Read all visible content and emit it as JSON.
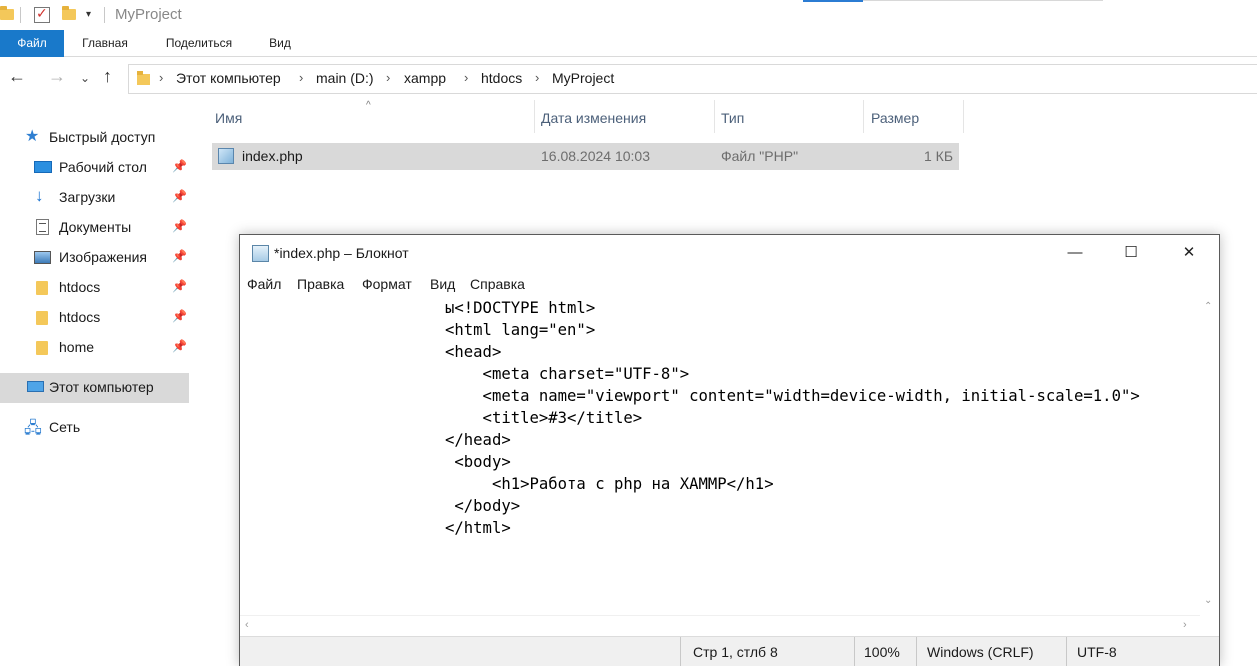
{
  "explorer": {
    "window_title": "MyProject",
    "ribbon": {
      "file": "Файл",
      "home": "Главная",
      "share": "Поделиться",
      "view": "Вид"
    },
    "breadcrumb": [
      "Этот компьютер",
      "main (D:)",
      "xampp",
      "htdocs",
      "MyProject"
    ],
    "nav_pane": {
      "quick_access": "Быстрый доступ",
      "desktop": "Рабочий стол",
      "downloads": "Загрузки",
      "documents": "Документы",
      "pictures": "Изображения",
      "htdocs1": "htdocs",
      "htdocs2": "htdocs",
      "home": "home",
      "this_pc": "Этот компьютер",
      "network": "Сеть"
    },
    "columns": {
      "name": "Имя",
      "date": "Дата изменения",
      "type": "Тип",
      "size": "Размер"
    },
    "files": [
      {
        "name": "index.php",
        "date": "16.08.2024 10:03",
        "type": "Файл \"PHP\"",
        "size": "1 КБ"
      }
    ]
  },
  "notepad": {
    "title": "*index.php – Блокнот",
    "menu": {
      "file": "Файл",
      "edit": "Правка",
      "format": "Формат",
      "view": "Вид",
      "help": "Справка"
    },
    "content": "ы<!DOCTYPE html>\n<html lang=\"en\">\n<head>\n    <meta charset=\"UTF-8\">\n    <meta name=\"viewport\" content=\"width=device-width, initial-scale=1.0\">\n    <title>#3</title>\n</head>\n <body>\n     <h1>Работа с php на XAMMP</h1>\n </body>\n</html>",
    "status": {
      "position": "Стр 1, стлб 8",
      "zoom": "100%",
      "line_endings": "Windows (CRLF)",
      "encoding": "UTF-8"
    }
  }
}
